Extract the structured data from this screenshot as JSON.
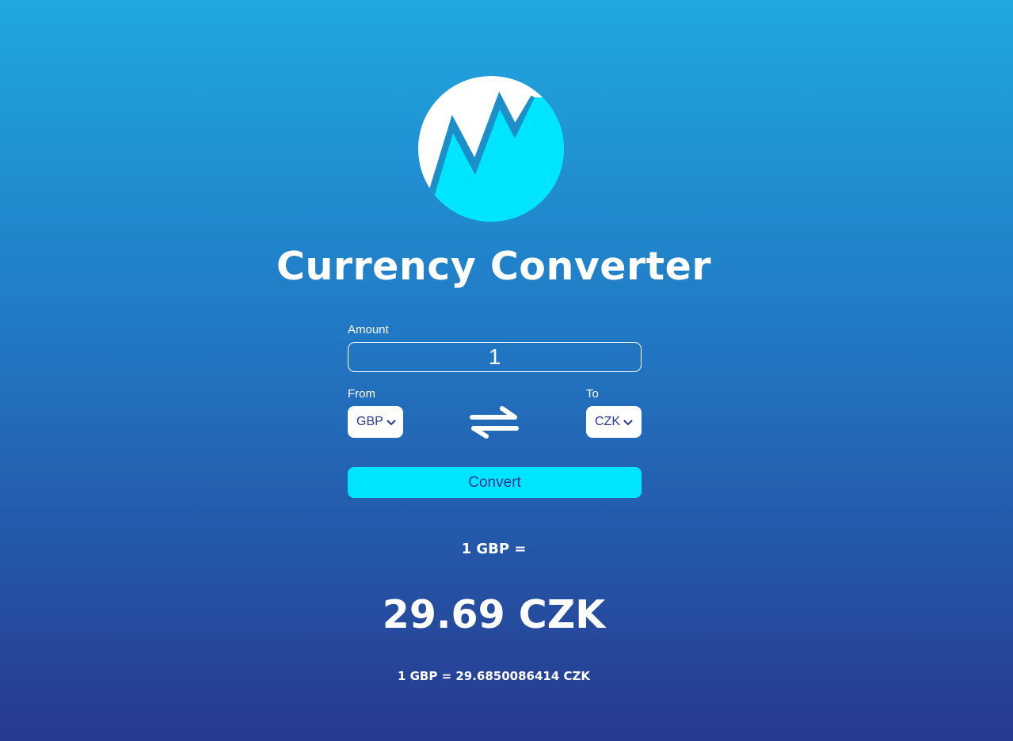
{
  "header": {
    "logo_icon": "chart-zigzag-logo-icon",
    "title": "Currency Converter"
  },
  "form": {
    "amount_label": "Amount",
    "amount_value": "1",
    "from_label": "From",
    "from_currency": "GBP",
    "to_label": "To",
    "to_currency": "CZK",
    "swap_icon": "swap-arrows-icon",
    "convert_label": "Convert"
  },
  "result": {
    "base": "1 GBP =",
    "converted": "29.69 CZK",
    "detail": "1 GBP = 29.6850086414 CZK"
  },
  "colors": {
    "accent": "#00e5ff",
    "text_dark": "#27398f",
    "gradient_top": "#1fa8e0",
    "gradient_bottom": "#27398f"
  }
}
